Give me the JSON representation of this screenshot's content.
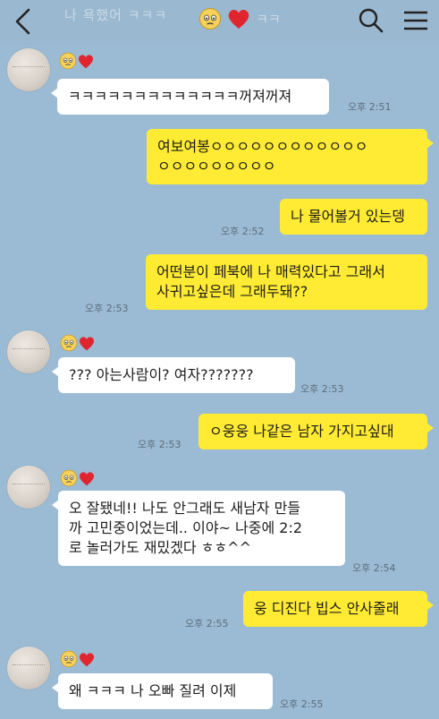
{
  "header": {
    "title_ghost": "나 욕했어 ㅋㅋㅋ",
    "title_suffix": "ㅋㅋ",
    "icons": [
      "back-icon",
      "worried-face-icon",
      "heart-icon",
      "search-icon",
      "menu-icon"
    ]
  },
  "contact": {
    "name_icons": [
      "worried-face-icon",
      "heart-icon"
    ],
    "avatar_icon": "avatar-sketch"
  },
  "messages": [
    {
      "side": "in",
      "text": "ㅋㅋㅋㅋㅋㅋㅋㅋㅋㅋㅋㅋㅋ꺼져꺼져",
      "time": "오후 2:51"
    },
    {
      "side": "out",
      "text": "여보여봉ㅇㅇㅇㅇㅇㅇㅇㅇㅇㅇㅇㅇ\nㅇㅇㅇㅇㅇㅇㅇㅇㅇ",
      "time": ""
    },
    {
      "side": "out",
      "text": "나 물어볼거 있는뎅",
      "time": "오후 2:52"
    },
    {
      "side": "out",
      "text": "어떤분이 페북에 나 매력있다고 그래서\n사귀고싶은데 그래두돼??",
      "time": "오후 2:53"
    },
    {
      "side": "in",
      "text": "??? 아는사람이? 여자???????",
      "time": "오후 2:53"
    },
    {
      "side": "out",
      "text": "ㅇ웅웅 나같은 남자 가지고싶대",
      "time": "오후 2:53"
    },
    {
      "side": "in",
      "text": "오 잘됐네!! 나도 안그래도 새남자 만들\n까 고민중이었는데.. 이야~ 나중에 2:2\n로 놀러가도 재밌겠다 ㅎㅎ^^",
      "time": "오후 2:54"
    },
    {
      "side": "out",
      "text": "웅 디진다 빕스 안사줄래",
      "time": "오후 2:55"
    },
    {
      "side": "in",
      "text": "왜 ㅋㅋㅋ 나 오빠 질려 이제",
      "time": "오후 2:55"
    }
  ],
  "colors": {
    "background": "#9bbbd4",
    "outgoing_bubble": "#ffeb33",
    "incoming_bubble": "#ffffff",
    "heart": "#e0252f"
  }
}
